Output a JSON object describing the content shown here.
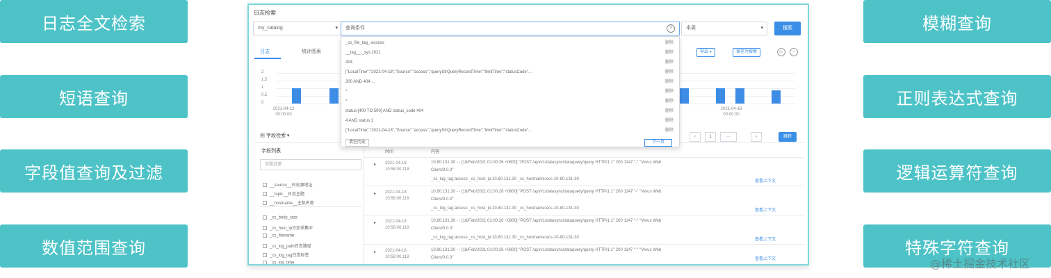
{
  "features_left": [
    "日志全文检索",
    "短语查询",
    "字段值查询及过滤",
    "数值范围查询"
  ],
  "features_right": [
    "模糊查询",
    "正则表达式查询",
    "逻辑运算符查询",
    "特殊字符查询"
  ],
  "panel": {
    "title": "日志检索",
    "workspace": "my_catalog",
    "query_placeholder": "查询条件",
    "help": "?",
    "time_range": "本周",
    "search_button": "搜索",
    "tabs": [
      "日志",
      "统计图表"
    ],
    "export_button": "导出 ▾",
    "save_button": "保存为搜索",
    "play_icon": "▷",
    "minus_icon": "−"
  },
  "chart_data": {
    "type": "bar",
    "yticks": [
      "2",
      "1.5",
      "1",
      "0.5",
      "0"
    ],
    "x_labels": [
      "2021-04-12\n00:00:00",
      "2021-04-18\n00:00:00"
    ],
    "values": [
      1,
      1,
      1,
      1,
      1,
      1,
      0.85
    ],
    "ylim": [
      0,
      2
    ]
  },
  "dropdown": {
    "rows": [
      {
        "text": "_cs_file_tag_:access",
        "action": "删除"
      },
      {
        "text": "__tag__:_sys:2021",
        "action": "删除"
      },
      {
        "text": "404",
        "action": "删除"
      },
      {
        "text": "[\"LocalTime\":\"2021-04-18\",\"Source\":\"access\",\"queryStrQueryRecordTime\":\"limitTime\":\"statusCode\"...",
        "action": "删除"
      },
      {
        "text": "200 AND 404 ...",
        "action": "删除"
      },
      {
        "text": "*",
        "action": "删除"
      },
      {
        "text": "*",
        "action": "删除"
      },
      {
        "text": "status:[400 TO 500] AND status_code:404",
        "action": "删除"
      },
      {
        "text": "4 AND status:1",
        "action": "删除"
      },
      {
        "text": "[\"LocalTime\":\"2021-04-18\",\"Source\":\"access\",\"queryStrQueryRecordTime\":\"limitTime\":\"statusCode\"...",
        "action": "删除"
      }
    ],
    "clear_button": "清空历史",
    "next_button": "下一页"
  },
  "fields": {
    "header": "字段检索",
    "list_label": "字段列表",
    "filter_placeholder": "字段过滤",
    "group1": [
      "__source__日志源地址",
      "__topic__日志主题",
      "__hostname__主机名称"
    ],
    "group2": [
      "_cs_body_size",
      "_cs_host_ip日志采集IP",
      "_cs_filename",
      "_cs_log_path日志路径",
      "_cs_log_tag日志标签",
      "_cs_log_time"
    ]
  },
  "pagination": {
    "prev": "‹",
    "page": "1",
    "dots": "···",
    "next": "›",
    "jump": "跳转"
  },
  "table": {
    "col_time": "时间",
    "col_content": "内容",
    "toggle": "▸",
    "rows": [
      {
        "time": "2021-04-18 10:58:00.118",
        "lines": [
          "10.80.131.30 - - [18/Feb/2021:01:00:26 +0800] \"POST /api/v1/datasync/dataquery/query HTTP/1.1\" 200 1147 \"-\" \"Verus Web",
          "Client/3.0.0\"",
          "_cs_log_tag:access    _cs_host_ip:10.80.131.30    _cs_hostname:ecs-10-80-131-30"
        ],
        "ctx": "查看上下文"
      },
      {
        "time": "2021-04-18 10:58:00.118",
        "lines": [
          "10.80.131.30 - - [18/Feb/2021:01:00:26 +0800] \"POST /api/v1/datasync/dataquery/query HTTP/1.1\" 200 1147 \"-\" \"Verus Web",
          "Client/3.0.0\"",
          "_cs_log_tag:access    _cs_host_ip:10.80.131.30    _cs_hostname:ecs-10-80-131-30"
        ],
        "ctx": "查看上下文"
      },
      {
        "time": "2021-04-18 10:58:00.118",
        "lines": [
          "10.80.131.30 - - [18/Feb/2021:01:00:26 +0800] \"POST /api/v1/datasync/dataquery/query HTTP/1.1\" 200 1147 \"-\" \"Verus Web",
          "Client/3.0.0\"",
          "_cs_log_tag:access    _cs_host_ip:10.80.131.30    _cs_hostname:ecs-10-80-131-30"
        ],
        "ctx": "查看上下文"
      },
      {
        "time": "2021-04-18 10:58:00.118",
        "lines": [
          "10.80.131.30 - - [18/Feb/2021:01:00:26 +0800] \"POST /api/v1/datasync/dataquery/query HTTP/1.1\" 200 1147 \"-\" \"Verus Web",
          "Client/3.0.0\""
        ],
        "ctx": "查看上下文"
      }
    ]
  },
  "watermark": "@稀土掘金技术社区"
}
